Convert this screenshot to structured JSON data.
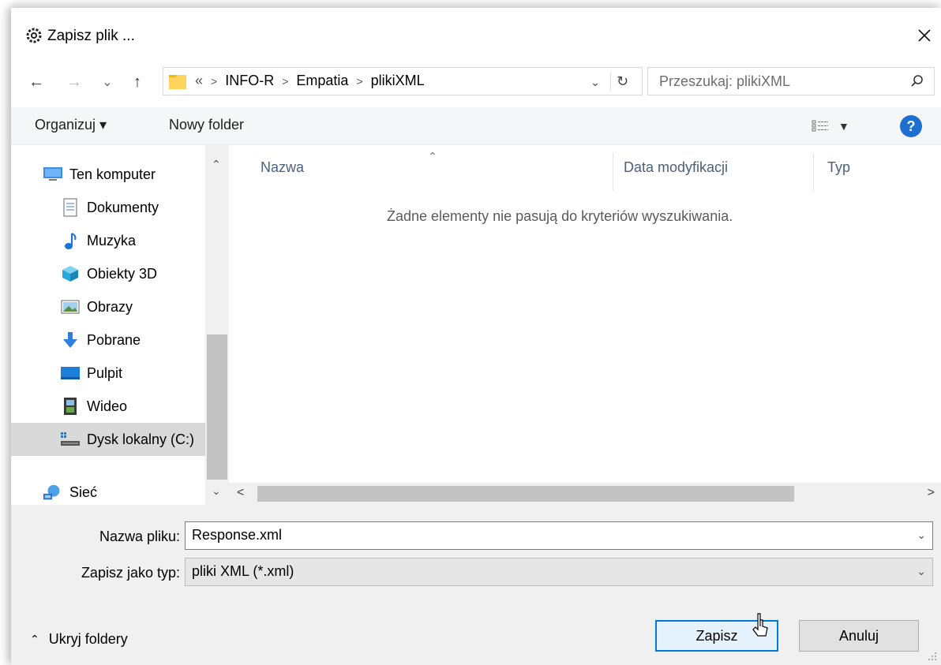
{
  "window": {
    "title": "Zapisz plik ..."
  },
  "nav": {
    "back": "←",
    "forward": "→",
    "recent": "⌄",
    "up": "↑",
    "breadcrumbs": [
      {
        "label": "«"
      },
      {
        "label": "INFO-R"
      },
      {
        "label": "Empatia"
      },
      {
        "label": "plikiXML"
      }
    ],
    "search_placeholder": "Przeszukaj: plikiXML"
  },
  "toolbar": {
    "organize": "Organizuj ▾",
    "new_folder": "Nowy folder"
  },
  "sidebar": {
    "items": [
      {
        "label": "Ten komputer",
        "icon": "computer-icon"
      },
      {
        "label": "Dokumenty",
        "icon": "documents-icon"
      },
      {
        "label": "Muzyka",
        "icon": "music-icon"
      },
      {
        "label": "Obiekty 3D",
        "icon": "objects-3d-icon"
      },
      {
        "label": "Obrazy",
        "icon": "pictures-icon"
      },
      {
        "label": "Pobrane",
        "icon": "downloads-icon"
      },
      {
        "label": "Pulpit",
        "icon": "desktop-icon"
      },
      {
        "label": "Wideo",
        "icon": "video-icon"
      },
      {
        "label": "Dysk lokalny (C:)",
        "icon": "local-disk-icon",
        "selected": true
      },
      {
        "label": "Sieć",
        "icon": "network-icon"
      }
    ]
  },
  "filelist": {
    "columns": [
      "Nazwa",
      "Data modyfikacji",
      "Typ"
    ],
    "empty_message": "Żadne elementy nie pasują do kryteriów wyszukiwania."
  },
  "form": {
    "filename_label": "Nazwa pliku:",
    "filename_value": "Response.xml",
    "filetype_label": "Zapisz jako typ:",
    "filetype_value": "pliki XML (*.xml)",
    "hide_folders": "Ukryj foldery",
    "save": "Zapisz",
    "cancel": "Anuluj"
  },
  "colors": {
    "accent": "#0078d7",
    "help": "#1e6fd0"
  }
}
